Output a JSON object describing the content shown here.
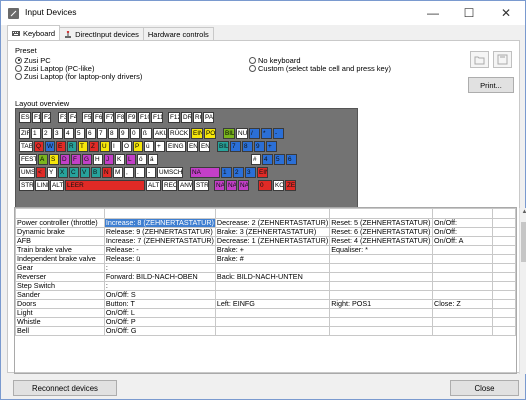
{
  "window": {
    "title": "Input Devices",
    "minimize": "—",
    "maximize": "☐",
    "close": "✕"
  },
  "tabs": [
    {
      "label": "Keyboard",
      "active": true
    },
    {
      "label": "DirectInput devices",
      "active": false
    },
    {
      "label": "Hardware controls",
      "active": false
    }
  ],
  "preset": {
    "label": "Preset",
    "options_left": [
      "Zusi PC",
      "Zusi Laptop (PC-like)",
      "Zusi Laptop (for laptop-only drivers)"
    ],
    "options_right": [
      "No keyboard",
      "Custom (select table cell and press key)"
    ],
    "selected": "Zusi PC"
  },
  "buttons": {
    "print": "Print...",
    "reconnect": "Reconnect devices",
    "close": "Close"
  },
  "layout_label": "Layout overview",
  "colors": {
    "key_default": "#ffffff",
    "key_blue": "#2b6fd6",
    "key_red": "#e02a26",
    "key_yellow": "#f6e70b",
    "key_green": "#7ab51d",
    "key_teal": "#27a39b",
    "key_purple": "#c33fc8",
    "key_orange": "#f0a040",
    "board": "#737373",
    "selection": "#3f7fd1"
  },
  "keyboard": {
    "rows": [
      [
        {
          "l": "ESC",
          "c": "key_default"
        },
        {
          "l": "F1",
          "c": "key_default"
        },
        {
          "l": "F2",
          "c": "key_default"
        },
        {
          "l": "F3",
          "c": "key_default"
        },
        {
          "l": "F4",
          "c": "key_default"
        },
        {
          "l": "F5",
          "c": "key_default"
        },
        {
          "l": "F6",
          "c": "key_default"
        },
        {
          "l": "F7",
          "c": "key_default"
        },
        {
          "l": "F8",
          "c": "key_default"
        },
        {
          "l": "F9",
          "c": "key_default"
        },
        {
          "l": "F10",
          "c": "key_default"
        },
        {
          "l": "F11",
          "c": "key_default"
        },
        {
          "l": "F12",
          "c": "key_default"
        },
        {
          "l": "DRU",
          "c": "key_default"
        },
        {
          "l": "RO",
          "c": "key_default"
        },
        {
          "l": "PAU",
          "c": "key_default"
        }
      ],
      [
        {
          "l": "ZIR",
          "c": "key_default"
        },
        {
          "l": "1",
          "c": "key_default"
        },
        {
          "l": "2",
          "c": "key_default"
        },
        {
          "l": "3",
          "c": "key_default"
        },
        {
          "l": "4",
          "c": "key_default"
        },
        {
          "l": "5",
          "c": "key_default"
        },
        {
          "l": "6",
          "c": "key_default"
        },
        {
          "l": "7",
          "c": "key_default"
        },
        {
          "l": "8",
          "c": "key_default"
        },
        {
          "l": "9",
          "c": "key_default"
        },
        {
          "l": "0",
          "c": "key_default"
        },
        {
          "l": "ß",
          "c": "key_default"
        },
        {
          "l": "AKU",
          "c": "key_default"
        },
        {
          "l": "RÜCK",
          "c": "key_default"
        },
        {
          "l": "EIN",
          "c": "key_yellow"
        },
        {
          "l": "PO",
          "c": "key_yellow"
        },
        {
          "l": "BIL",
          "c": "key_green"
        },
        {
          "l": "NU",
          "c": "key_default"
        },
        {
          "l": "/",
          "c": "key_blue"
        },
        {
          "l": "*",
          "c": "key_blue"
        },
        {
          "l": "-",
          "c": "key_blue"
        }
      ],
      [
        {
          "l": "TABU",
          "c": "key_default"
        },
        {
          "l": "Q",
          "c": "key_red"
        },
        {
          "l": "W",
          "c": "key_blue"
        },
        {
          "l": "E",
          "c": "key_red"
        },
        {
          "l": "R",
          "c": "key_teal"
        },
        {
          "l": "T",
          "c": "key_yellow"
        },
        {
          "l": "Z",
          "c": "key_red"
        },
        {
          "l": "U",
          "c": "key_yellow"
        },
        {
          "l": "I",
          "c": "key_default"
        },
        {
          "l": "O",
          "c": "key_default"
        },
        {
          "l": "P",
          "c": "key_yellow"
        },
        {
          "l": "ü",
          "c": "key_default"
        },
        {
          "l": "+",
          "c": "key_default"
        },
        {
          "l": "EING",
          "c": "key_default"
        },
        {
          "l": "ENT",
          "c": "key_default"
        },
        {
          "l": "ENI",
          "c": "key_default"
        },
        {
          "l": "BIL",
          "c": "key_teal"
        },
        {
          "l": "7",
          "c": "key_blue"
        },
        {
          "l": "8",
          "c": "key_blue"
        },
        {
          "l": "9",
          "c": "key_blue"
        },
        {
          "l": "+",
          "c": "key_blue"
        }
      ],
      [
        {
          "l": "FESTS",
          "c": "key_default"
        },
        {
          "l": "A",
          "c": "key_green"
        },
        {
          "l": "S",
          "c": "key_yellow"
        },
        {
          "l": "D",
          "c": "key_purple"
        },
        {
          "l": "F",
          "c": "key_purple"
        },
        {
          "l": "G",
          "c": "key_purple"
        },
        {
          "l": "H",
          "c": "key_default"
        },
        {
          "l": "J",
          "c": "key_purple"
        },
        {
          "l": "K",
          "c": "key_default"
        },
        {
          "l": "L",
          "c": "key_purple"
        },
        {
          "l": "ö",
          "c": "key_default"
        },
        {
          "l": "ä",
          "c": "key_default"
        },
        {
          "l": "#",
          "c": "key_default"
        },
        {
          "l": "4",
          "c": "key_blue"
        },
        {
          "l": "5",
          "c": "key_blue"
        },
        {
          "l": "6",
          "c": "key_blue"
        }
      ],
      [
        {
          "l": "UMS",
          "c": "key_default"
        },
        {
          "l": "<",
          "c": "key_red"
        },
        {
          "l": "Y",
          "c": "key_default"
        },
        {
          "l": "X",
          "c": "key_teal"
        },
        {
          "l": "C",
          "c": "key_teal"
        },
        {
          "l": "V",
          "c": "key_teal"
        },
        {
          "l": "B",
          "c": "key_teal"
        },
        {
          "l": "N",
          "c": "key_red"
        },
        {
          "l": "M",
          "c": "key_default"
        },
        {
          "l": ",",
          "c": "key_default"
        },
        {
          "l": ".",
          "c": "key_default"
        },
        {
          "l": "-",
          "c": "key_default"
        },
        {
          "l": "UMSCHA",
          "c": "key_default"
        },
        {
          "l": "NA",
          "c": "key_purple"
        },
        {
          "l": "1",
          "c": "key_blue"
        },
        {
          "l": "2",
          "c": "key_blue"
        },
        {
          "l": "3",
          "c": "key_blue"
        },
        {
          "l": "EIN",
          "c": "key_red"
        }
      ],
      [
        {
          "l": "STRG",
          "c": "key_default"
        },
        {
          "l": "LINK",
          "c": "key_default"
        },
        {
          "l": "ALT",
          "c": "key_default"
        },
        {
          "l": "LEER",
          "c": "key_red"
        },
        {
          "l": "ALT",
          "c": "key_default"
        },
        {
          "l": "RECH",
          "c": "key_default"
        },
        {
          "l": "ANW",
          "c": "key_default"
        },
        {
          "l": "STRG",
          "c": "key_default"
        },
        {
          "l": "NA",
          "c": "key_purple"
        },
        {
          "l": "NA",
          "c": "key_purple"
        },
        {
          "l": "NA",
          "c": "key_purple"
        },
        {
          "l": "0",
          "c": "key_red"
        },
        {
          "l": "KO",
          "c": "key_default"
        },
        {
          "l": "ZE",
          "c": "key_red"
        }
      ]
    ]
  },
  "table": {
    "columns": [
      "",
      "",
      "",
      "",
      "",
      ""
    ],
    "rows": [
      [
        "Power controller (throttle)",
        "Increase: 8 (ZEHNERTASTATUR)",
        "Decrease: 2 (ZEHNERTASTATUR)",
        "Reset: 5 (ZEHNERTASTATUR)",
        "On/Off:",
        ""
      ],
      [
        "Dynamic brake",
        "Release: 9 (ZEHNERTASTATUR)",
        "Brake: 3 (ZEHNERTASTATUR)",
        "Reset: 6 (ZEHNERTASTATUR)",
        "On/Off:",
        ""
      ],
      [
        "AFB",
        "Increase: 7 (ZEHNERTASTATUR)",
        "Decrease: 1 (ZEHNERTASTATUR)",
        "Reset: 4 (ZEHNERTASTATUR)",
        "On/Off: A",
        ""
      ],
      [
        "Train brake valve",
        "Release: -",
        "Brake: +",
        "Equaliser: *",
        "",
        ""
      ],
      [
        "Independent brake valve",
        "Release: ü",
        "Brake: #",
        "",
        "",
        ""
      ],
      [
        "Gear",
        ":",
        "",
        "",
        "",
        ""
      ],
      [
        "Reverser",
        "Forward: BILD-NACH-OBEN",
        "Back: BILD-NACH-UNTEN",
        "",
        "",
        ""
      ],
      [
        "Step Switch",
        ":",
        "",
        "",
        "",
        ""
      ],
      [
        "Sander",
        "On/Off: S",
        "",
        "",
        "",
        ""
      ],
      [
        "Doors",
        "Button: T",
        "Left: EINFG",
        "Right: POS1",
        "Close: Z",
        ""
      ],
      [
        "Light",
        "On/Off: L",
        "",
        "",
        "",
        ""
      ],
      [
        "Whistle",
        "On/Off: P",
        "",
        "",
        "",
        ""
      ],
      [
        "Bell",
        "On/Off: G",
        "",
        "",
        "",
        ""
      ]
    ],
    "selected_cell": {
      "row": 0,
      "col": 1
    }
  },
  "icons": {
    "app": "input-devices-icon",
    "keyboard": "keyboard-icon",
    "joystick": "joystick-icon",
    "open": "open-file-icon",
    "save": "save-icon"
  }
}
